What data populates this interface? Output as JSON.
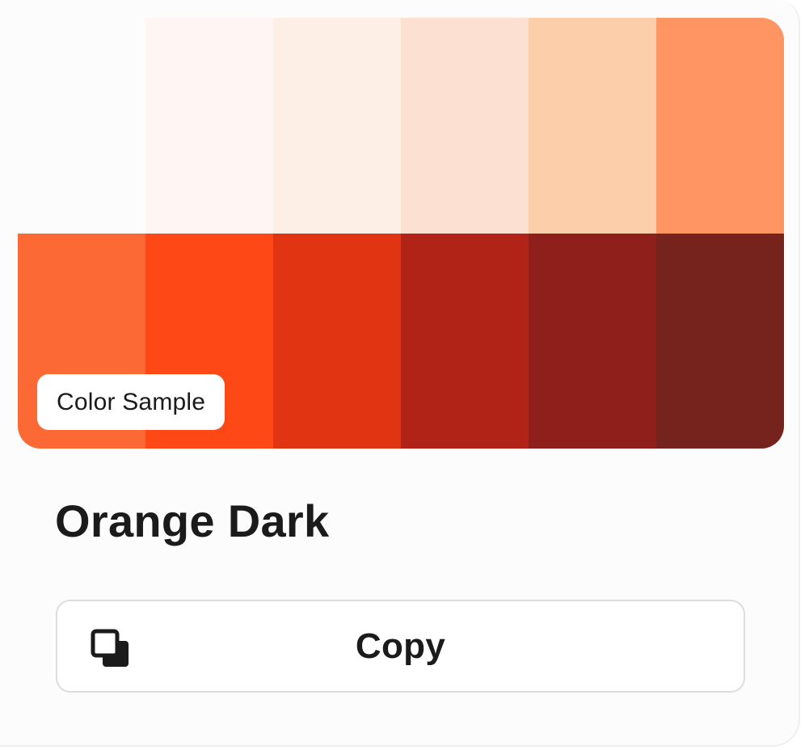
{
  "palette": {
    "colors": [
      "#fcfcfc",
      "#fff5f2",
      "#fdeee6",
      "#fce0d1",
      "#fcceaa",
      "#fe9562",
      "#fd6935",
      "#fe4815",
      "#e13412",
      "#b22317",
      "#8f1f1b",
      "#75231c"
    ]
  },
  "badge": {
    "label": "Color Sample"
  },
  "title": "Orange Dark",
  "copy_button": {
    "label": "Copy",
    "icon": "copy-icon"
  }
}
